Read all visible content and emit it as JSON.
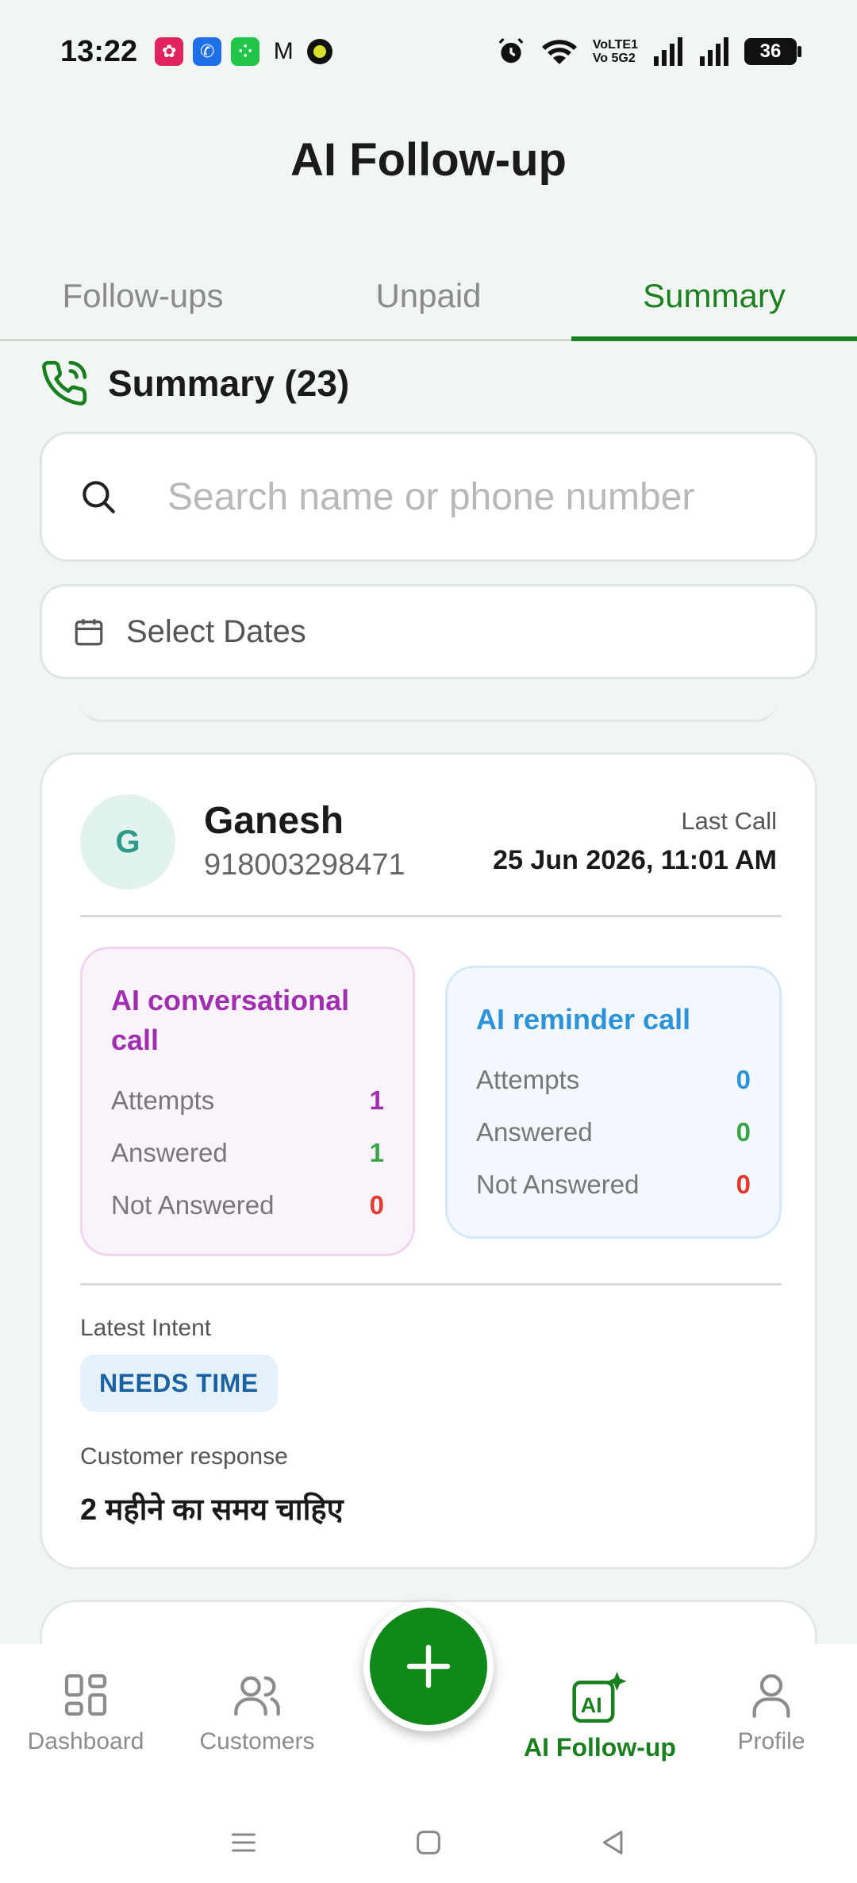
{
  "status_bar": {
    "time": "13:22",
    "battery": "36",
    "network_label_top": "VoLTE1",
    "network_label_bottom": "Vo 5G2"
  },
  "header": {
    "title": "AI Follow-up"
  },
  "tabs": [
    {
      "label": "Follow-ups",
      "active": false
    },
    {
      "label": "Unpaid",
      "active": false
    },
    {
      "label": "Summary",
      "active": true
    }
  ],
  "summary": {
    "heading": "Summary (23)"
  },
  "search": {
    "placeholder": "Search name or phone number",
    "value": ""
  },
  "date_filter": {
    "label": "Select Dates"
  },
  "card": {
    "avatar_initial": "G",
    "name": "Ganesh",
    "phone": "918003298471",
    "last_call_label": "Last Call",
    "last_call_value": "25 Jun 2026, 11:01 AM",
    "conversational": {
      "title": "AI conversational call",
      "rows": [
        {
          "label": "Attempts",
          "value": "1"
        },
        {
          "label": "Answered",
          "value": "1"
        },
        {
          "label": "Not Answered",
          "value": "0"
        }
      ]
    },
    "reminder": {
      "title": "AI reminder call",
      "rows": [
        {
          "label": "Attempts",
          "value": "0"
        },
        {
          "label": "Answered",
          "value": "0"
        },
        {
          "label": "Not Answered",
          "value": "0"
        }
      ]
    },
    "latest_intent_label": "Latest Intent",
    "latest_intent": "NEEDS TIME",
    "customer_response_label": "Customer response",
    "customer_response": "2 महीने का समय चाहिए"
  },
  "bottom_nav": [
    {
      "label": "Dashboard",
      "icon": "dashboard-icon"
    },
    {
      "label": "Customers",
      "icon": "customers-icon"
    },
    {
      "label": "",
      "icon": "plus-icon"
    },
    {
      "label": "AI Follow-up",
      "icon": "ai-sparkle-icon",
      "active": true
    },
    {
      "label": "Profile",
      "icon": "profile-icon"
    }
  ],
  "colors": {
    "brand_green": "#1a7f1f",
    "conversational_purple": "#a02fb0",
    "reminder_blue": "#2d93d9",
    "answered_green": "#3aa447",
    "not_answered_red": "#e3392e"
  }
}
